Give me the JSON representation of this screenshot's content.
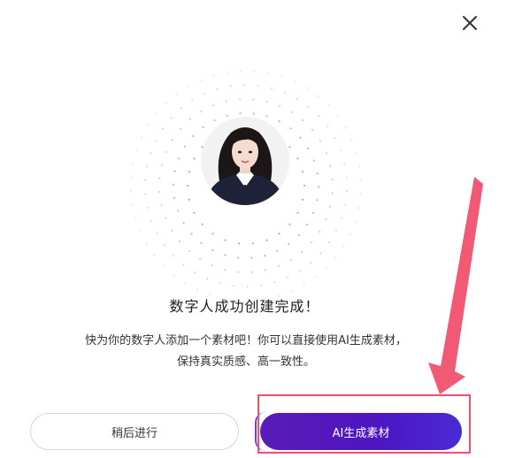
{
  "dialog": {
    "title": "数字人成功创建完成！",
    "description_line1": "快为你的数字人添加一个素材吧！你可以直接使用AI生成素材，",
    "description_line2": "保持真实质感、高一致性。",
    "later_button_label": "稍后进行",
    "ai_button_label": "AI生成素材",
    "close_icon": "close-icon",
    "accent_color": "#5a1bb8",
    "highlight_color": "#f0506e"
  }
}
